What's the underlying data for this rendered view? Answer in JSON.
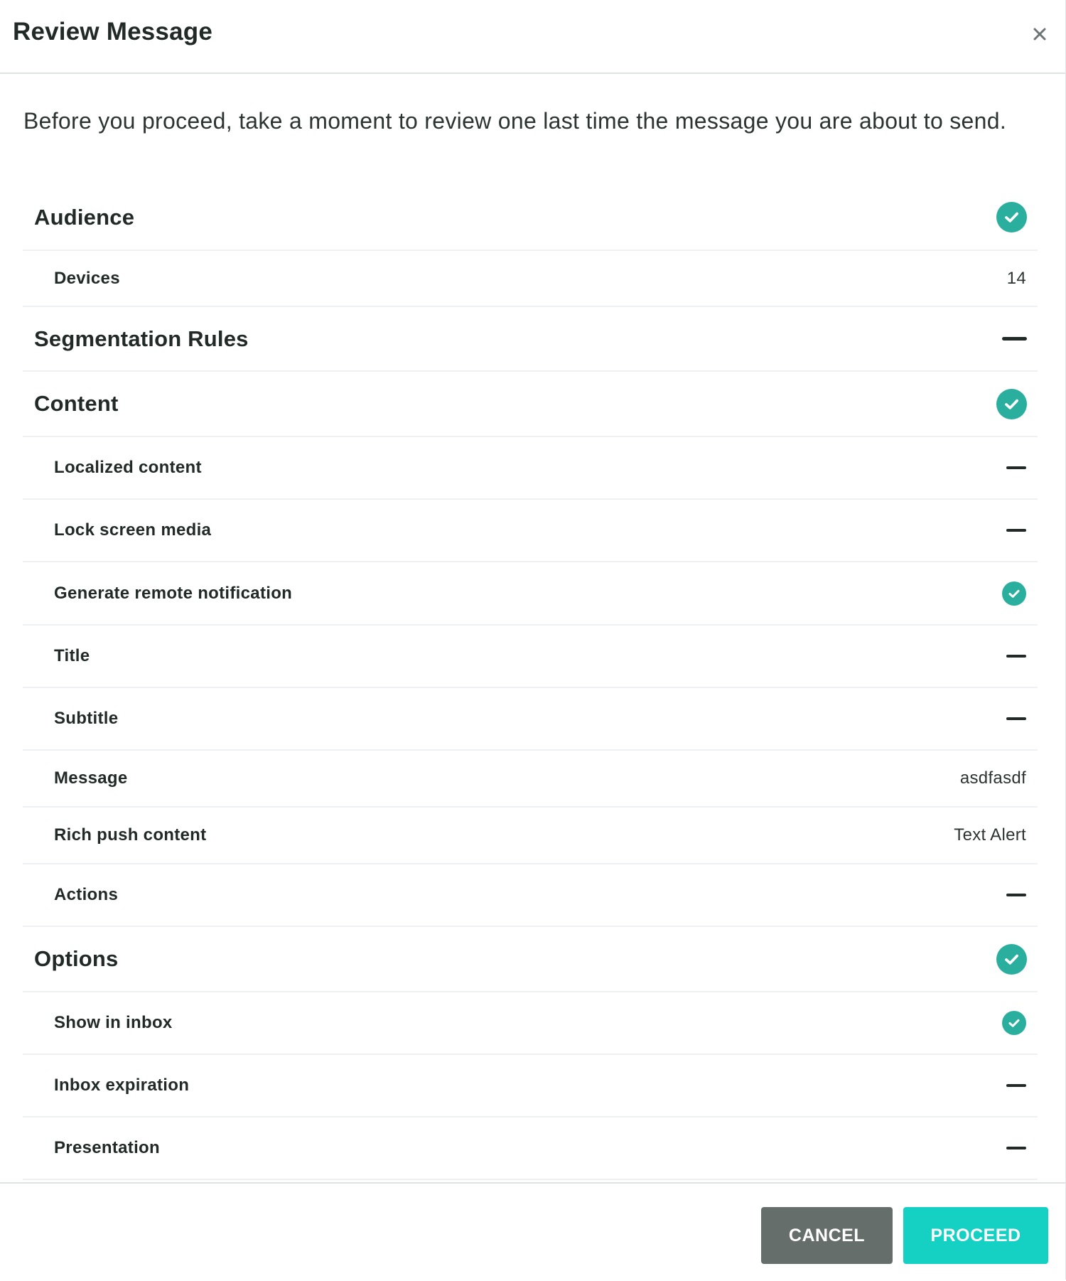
{
  "dialog": {
    "title": "Review Message",
    "close_icon": "close-icon",
    "intro": "Before you proceed, take a moment to review one last time the message you are about to send."
  },
  "colors": {
    "check_green": "#2aaf9f",
    "cancel_gray": "#666e6c",
    "proceed_teal": "#14d1c4",
    "text_dark": "#222a28"
  },
  "sections": [
    {
      "label": "Audience",
      "status": "check",
      "items": [
        {
          "label": "Devices",
          "value": "14",
          "status": "value"
        }
      ]
    },
    {
      "label": "Segmentation Rules",
      "status": "none",
      "items": []
    },
    {
      "label": "Content",
      "status": "check",
      "items": [
        {
          "label": "Localized content",
          "status": "none"
        },
        {
          "label": "Lock screen media",
          "status": "none"
        },
        {
          "label": "Generate remote notification",
          "status": "check"
        },
        {
          "label": "Title",
          "status": "none"
        },
        {
          "label": "Subtitle",
          "status": "none"
        },
        {
          "label": "Message",
          "value": "asdfasdf",
          "status": "value"
        },
        {
          "label": "Rich push content",
          "value": "Text Alert",
          "status": "value"
        },
        {
          "label": "Actions",
          "status": "none"
        }
      ]
    },
    {
      "label": "Options",
      "status": "check",
      "items": [
        {
          "label": "Show in inbox",
          "status": "check"
        },
        {
          "label": "Inbox expiration",
          "status": "none"
        },
        {
          "label": "Presentation",
          "status": "none"
        }
      ]
    }
  ],
  "footer": {
    "cancel_label": "CANCEL",
    "proceed_label": "PROCEED"
  }
}
